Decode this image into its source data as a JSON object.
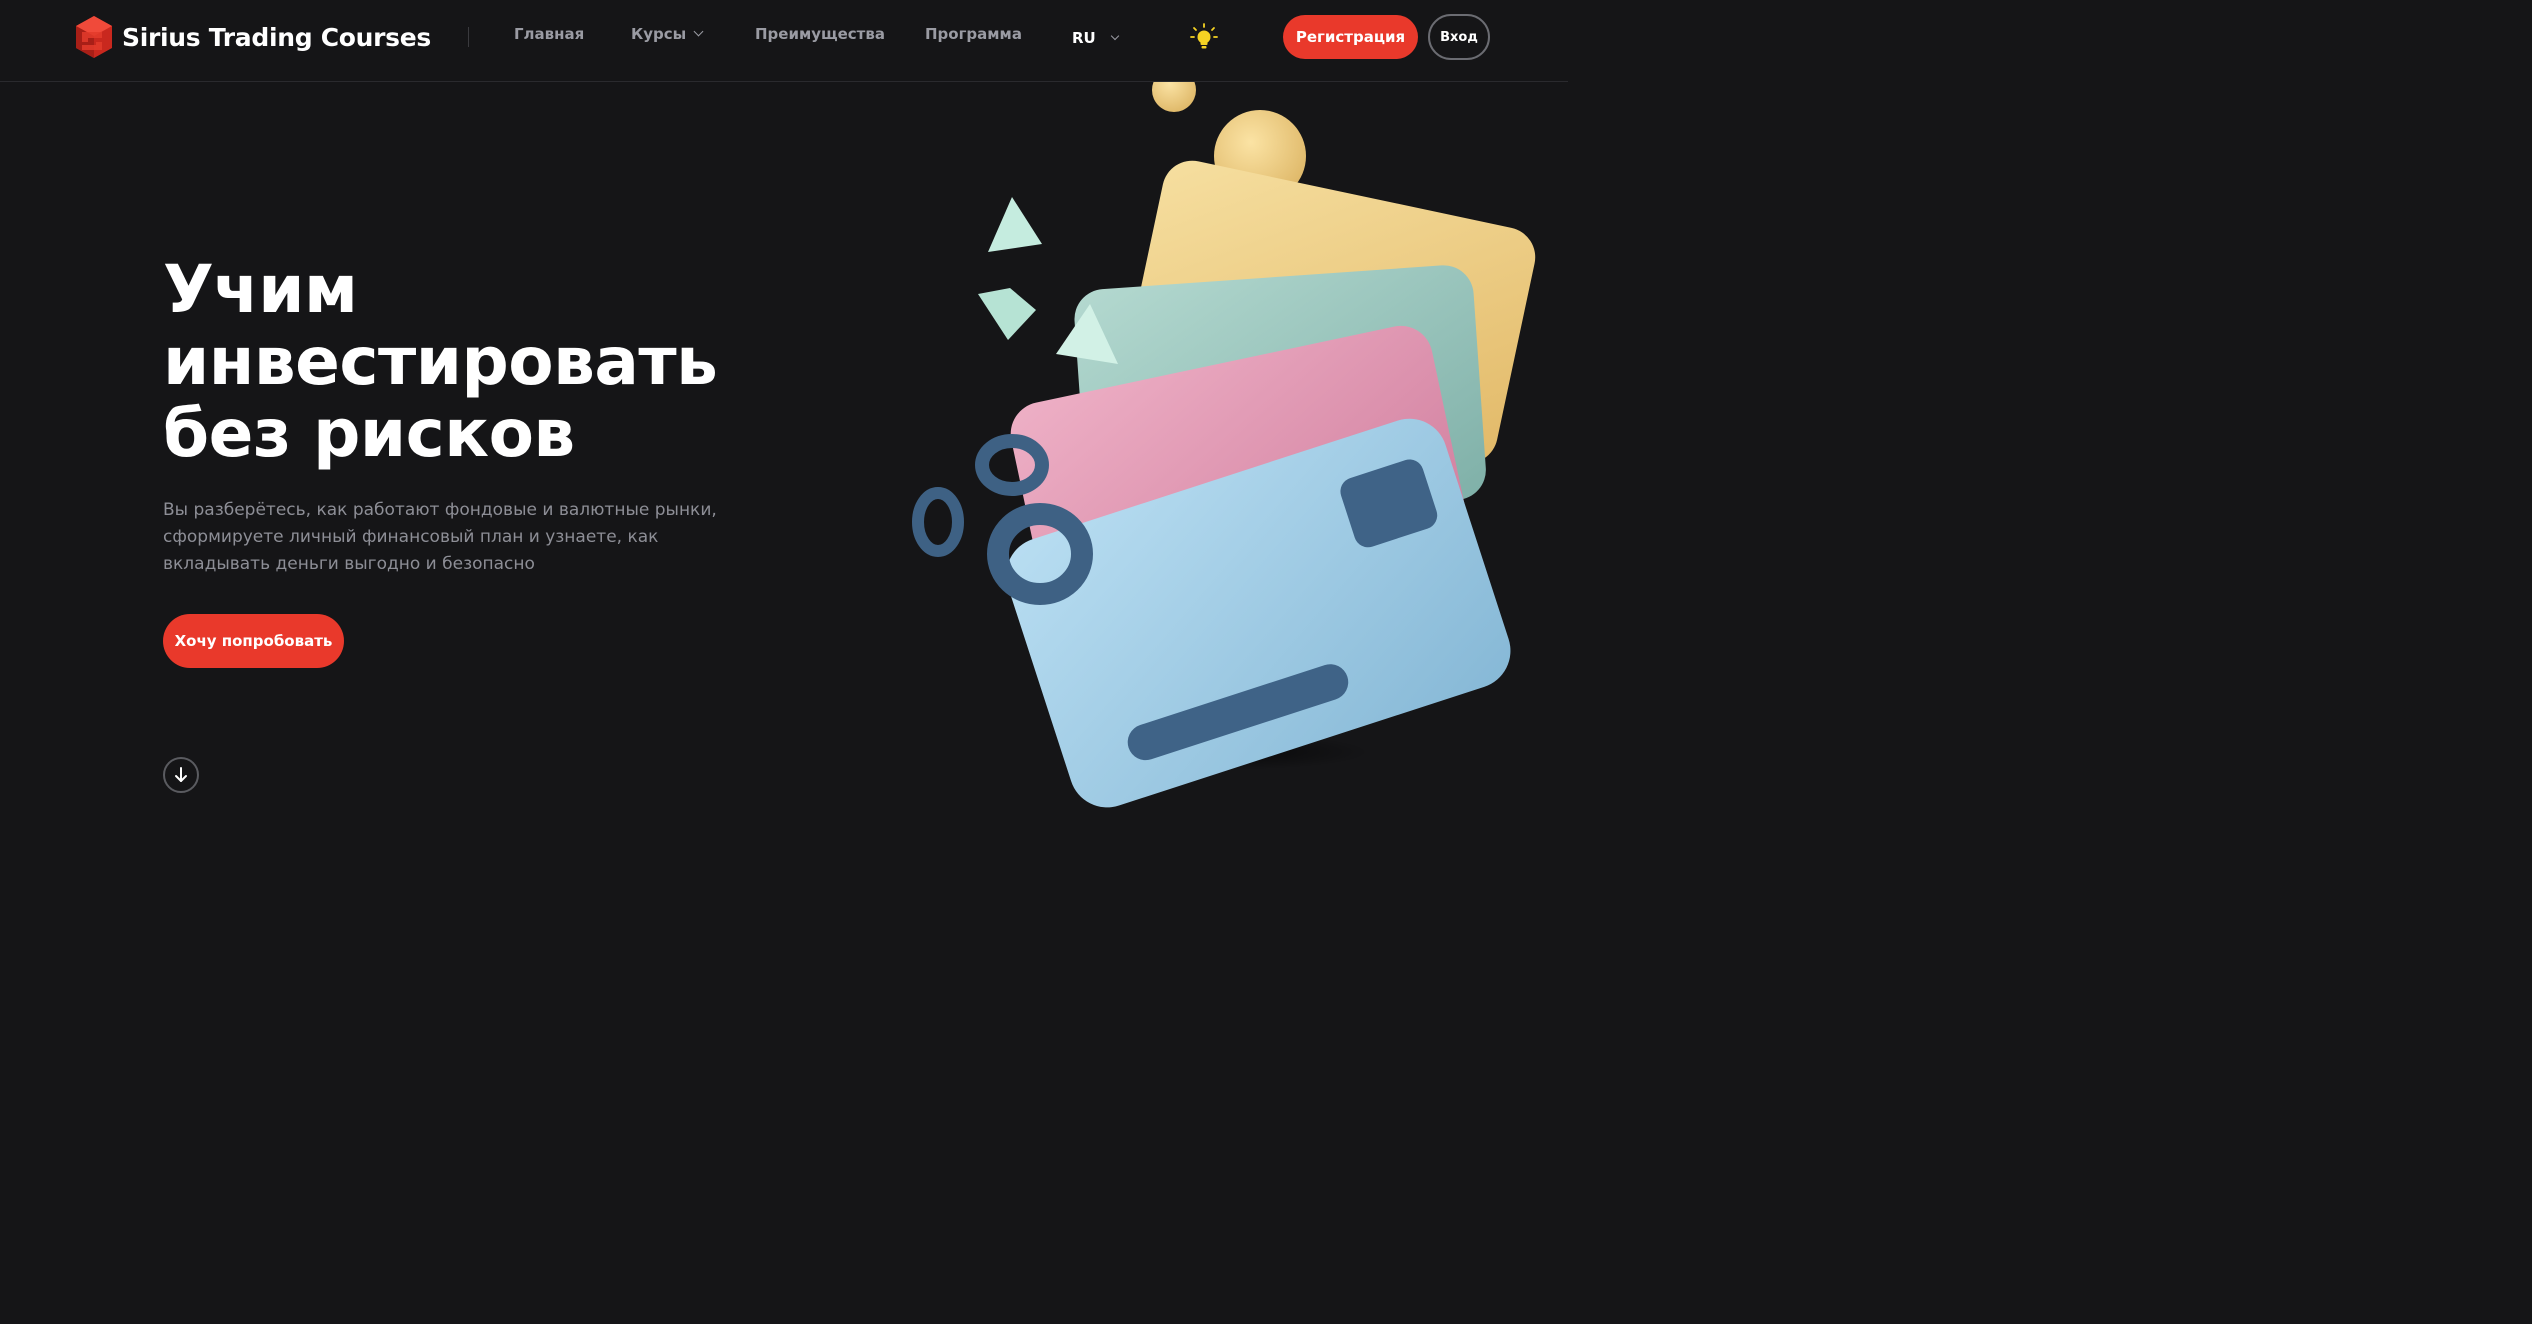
{
  "header": {
    "brand": "Sirius Trading Courses",
    "nav": [
      {
        "label": "Главная"
      },
      {
        "label": "Курсы"
      },
      {
        "label": "Преимущества"
      },
      {
        "label": "Программа"
      }
    ],
    "language": "RU",
    "register_label": "Регистрация",
    "login_label": "Вход",
    "theme_icon": "lightbulb-icon"
  },
  "hero": {
    "title_lines": [
      "Учим",
      "инвестировать",
      "без рисков"
    ],
    "description": "Вы разберётесь, как работают фондовые и валютные рынки, сформируете личный финансовый план и узнаете, как вкладывать деньги выгодно и безопасно",
    "cta_label": "Хочу попробовать",
    "scroll_icon": "arrow-down-icon"
  },
  "colors": {
    "background": "#151517",
    "accent": "#e9392b",
    "nav_text": "#9a9ba3",
    "description_text": "#8d8e96",
    "card_yellow": "#f0d08a",
    "card_green": "#9cc7bf",
    "card_pink": "#e39ab4",
    "card_blue": "#9ccbe6",
    "shape_mint": "#c5ecdf",
    "ring_blue": "#3e6184"
  }
}
